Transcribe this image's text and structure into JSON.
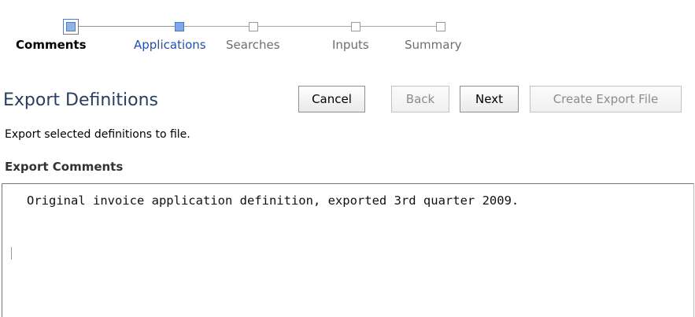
{
  "train": {
    "steps": [
      {
        "label": "Comments",
        "state": "current"
      },
      {
        "label": "Applications",
        "state": "visited"
      },
      {
        "label": "Searches",
        "state": "pending"
      },
      {
        "label": "Inputs",
        "state": "pending"
      },
      {
        "label": "Summary",
        "state": "pending"
      }
    ]
  },
  "header": {
    "title": "Export Definitions"
  },
  "buttons": {
    "cancel": "Cancel",
    "back": "Back",
    "next": "Next",
    "create": "Create Export File"
  },
  "instructions": "Export selected definitions to file.",
  "comments_field": {
    "label": "Export Comments",
    "value": "Original invoice application definition, exported 3rd quarter 2009."
  },
  "colors": {
    "title": "#2a3e5f",
    "link": "#1f4fb0",
    "train_active": "#7fa8ea"
  }
}
